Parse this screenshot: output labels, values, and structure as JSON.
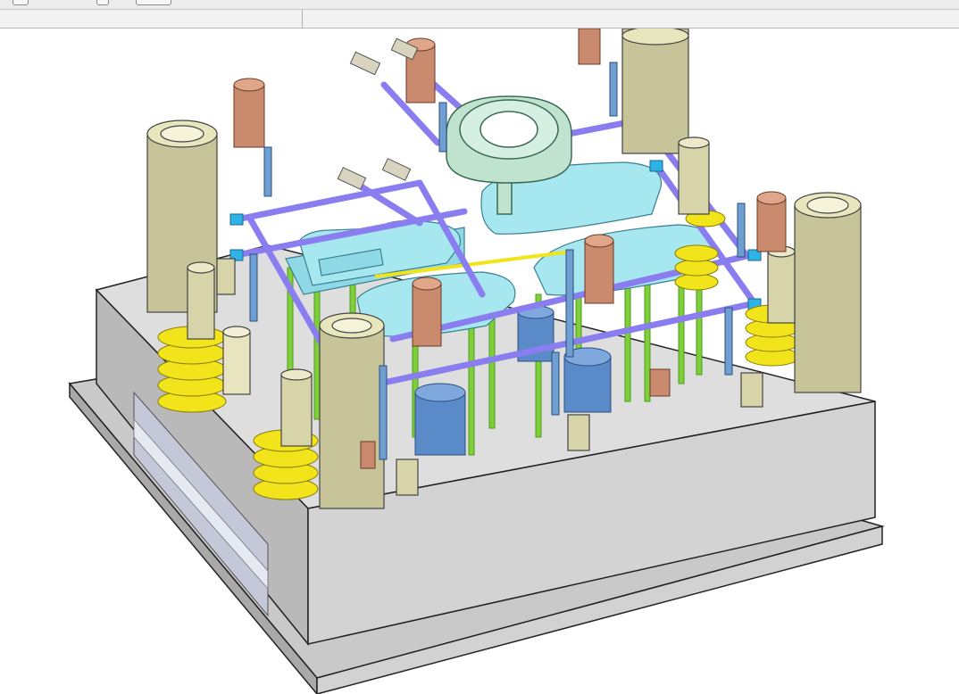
{
  "colors": {
    "background": "#ffffff",
    "plate_top": "#dcdcdc",
    "plate_side": "#c8c8c8",
    "guide_pillar": "#c8c49a",
    "guide_bushing": "#e8e6bd",
    "spring": "#f2e41b",
    "cooling_line": "#8a7df0",
    "connector": "#2fb2e6",
    "ejector_pin": "#7fcf3a",
    "cavity_insert": "#9fe4ee",
    "sprue_ring": "#bfe3cf",
    "socket_screw": "#c98a6e",
    "small_bolt": "#6e9fd0",
    "support_pillar": "#5a8ac8"
  },
  "icons": [
    "window-icon",
    "toolbar-icon",
    "grid-icon"
  ]
}
